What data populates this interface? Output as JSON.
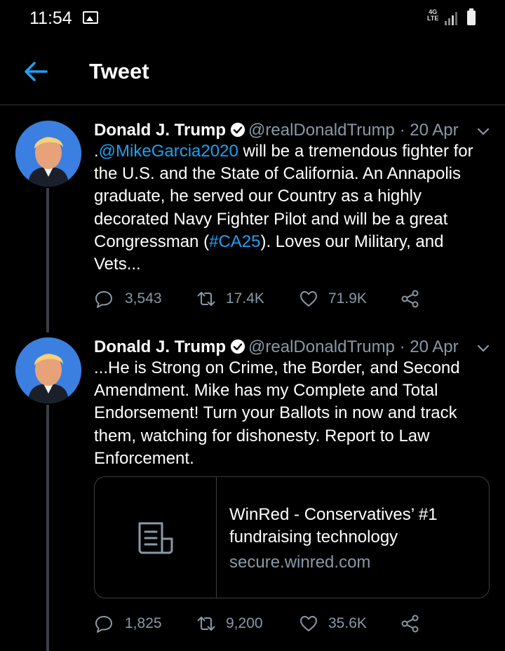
{
  "status_bar": {
    "time": "11:54",
    "network_type": "4G LTE",
    "icons": [
      "gallery-icon",
      "signal-icon",
      "battery-icon"
    ]
  },
  "header": {
    "title": "Tweet",
    "back_icon": "back-arrow-icon"
  },
  "tweets": [
    {
      "display_name": "Donald J. Trump",
      "handle": "@realDonaldTrump",
      "separator": "·",
      "date": "20 Apr",
      "text_parts": {
        "prefix": ".",
        "mention": "@MikeGarcia2020",
        "middle": " will be a tremendous fighter for the U.S. and the State of California. An Annapolis graduate, he served our Country as a highly decorated Navy Fighter Pilot and will be a great Congressman (",
        "hashtag": "#CA25",
        "suffix": "). Loves our Military, and Vets..."
      },
      "replies": "3,543",
      "retweets": "17.4K",
      "likes": "71.9K"
    },
    {
      "display_name": "Donald J. Trump",
      "handle": "@realDonaldTrump",
      "separator": "·",
      "date": "20 Apr",
      "text": "...He is Strong on Crime, the Border, and Second Amendment. Mike has my Complete and Total Endorsement! Turn your Ballots in now and track them, watching for dishonesty. Report to Law Enforcement.",
      "card": {
        "title": "WinRed - Conservatives’ #1 fundraising technology",
        "domain": "secure.winred.com",
        "icon": "document-icon"
      },
      "replies": "1,825",
      "retweets": "9,200",
      "likes": "35.6K"
    }
  ],
  "colors": {
    "background": "#000000",
    "accent": "#1da1f2",
    "secondary_text": "#8899a6",
    "divider": "#2f3336"
  }
}
